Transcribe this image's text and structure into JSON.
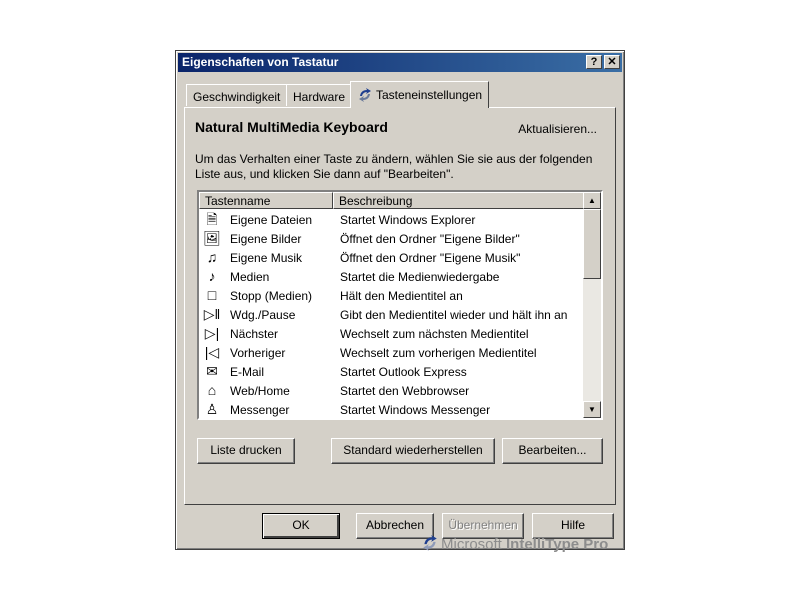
{
  "window": {
    "title": "Eigenschaften von Tastatur",
    "help_label": "?",
    "close_label": "✕"
  },
  "tabs": [
    {
      "label": "Geschwindigkeit",
      "selected": false
    },
    {
      "label": "Hardware",
      "selected": false
    },
    {
      "label": "Tasteneinstellungen",
      "selected": true
    }
  ],
  "panel": {
    "heading": "Natural MultiMedia Keyboard",
    "refresh_link": "Aktualisieren...",
    "instructions": "Um das Verhalten einer Taste zu ändern, wählen Sie sie aus der folgenden Liste aus, und klicken Sie dann auf \"Bearbeiten\"."
  },
  "list": {
    "columns": [
      "Tastenname",
      "Beschreibung"
    ],
    "rows": [
      {
        "icon": "documents-icon",
        "glyph": "🗎",
        "name": "Eigene Dateien",
        "description": "Startet Windows Explorer"
      },
      {
        "icon": "pictures-icon",
        "glyph": "🖼",
        "name": "Eigene Bilder",
        "description": "Öffnet den Ordner \"Eigene Bilder\""
      },
      {
        "icon": "music-folder-icon",
        "glyph": "♫",
        "name": "Eigene Musik",
        "description": "Öffnet den Ordner \"Eigene Musik\""
      },
      {
        "icon": "music-note-icon",
        "glyph": "♪",
        "name": "Medien",
        "description": "Startet die Medienwiedergabe"
      },
      {
        "icon": "stop-icon",
        "glyph": "□",
        "name": "Stopp (Medien)",
        "description": "Hält den Medientitel an"
      },
      {
        "icon": "play-pause-icon",
        "glyph": "▷‖",
        "name": "Wdg./Pause",
        "description": "Gibt den Medientitel wieder und hält ihn an"
      },
      {
        "icon": "next-track-icon",
        "glyph": "▷|",
        "name": "Nächster",
        "description": "Wechselt zum nächsten Medientitel"
      },
      {
        "icon": "previous-track-icon",
        "glyph": "|◁",
        "name": "Vorheriger",
        "description": "Wechselt zum vorherigen Medientitel"
      },
      {
        "icon": "email-icon",
        "glyph": "✉",
        "name": "E-Mail",
        "description": "Startet Outlook Express"
      },
      {
        "icon": "home-icon",
        "glyph": "⌂",
        "name": "Web/Home",
        "description": "Startet den Webbrowser"
      },
      {
        "icon": "messenger-icon",
        "glyph": "♙",
        "name": "Messenger",
        "description": "Startet Windows Messenger"
      }
    ]
  },
  "actions": {
    "print_label": "Liste drucken",
    "restore_label": "Standard wiederherstellen",
    "edit_label": "Bearbeiten..."
  },
  "brand": {
    "prefix": "Microsoft ",
    "product": "IntelliType Pro"
  },
  "footer": {
    "ok_label": "OK",
    "cancel_label": "Abbrechen",
    "apply_label": "Übernehmen",
    "help_label": "Hilfe"
  },
  "colors": {
    "titlebar_start": "#0a246a",
    "titlebar_end": "#3a6ea5",
    "face": "#d4d0c8"
  }
}
